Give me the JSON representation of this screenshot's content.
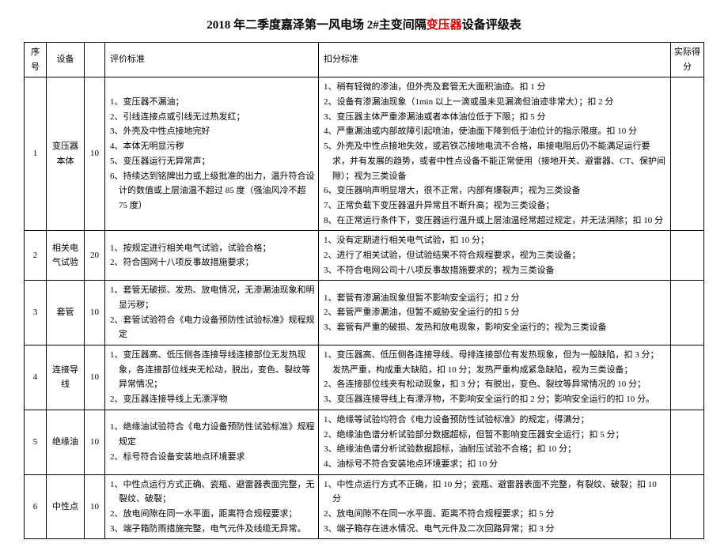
{
  "title_prefix": "2018 年二季度嘉泽第一风电场 2#主变间隔",
  "title_red": "变压器",
  "title_suffix": "设备评级表",
  "headers": {
    "seq": "序号",
    "dev": "设备",
    "score": "",
    "eval": "评价标准",
    "deduct": "扣分标准",
    "actual": "实际得分"
  },
  "rows": [
    {
      "seq": "1",
      "dev": "变压器本体",
      "score": "10",
      "eval": [
        "1、变压器不漏油；",
        "2、引线连接点或引线无过热发红；",
        "3、外壳及中性点接地完好",
        "4、本体无明显污秽",
        "5、变压器运行无异常声；",
        "6、持续达到铭牌出力或上级批准的出力，温升符合设计的数值或上层油温不超过 85 度（强油风冷不超 75 度）"
      ],
      "deduct": [
        "1、稍有轻微的渗油，但外壳及套管无大面积油迹。扣 1 分",
        "2、设备有渗漏油现象（1min 以上一滴或虽未见漏滴但油迹非常大）；扣 2 分",
        "3、变压器主体严重渗漏油或者本体油位低于下限；扣 5 分",
        "4、严重漏油或内部故障引起喷油，使油面下降到低于油位计的指示限度。扣 10 分",
        "5、外壳及中性点接地失效，或若铁芯接地电流不合格，串接电阻后仍不能满足运行要求，并有发展的趋势，或者中性点设备不能正常使用（接地开关、避雷器、CT、保护间隙）；视为三类设备",
        "6、变压器响声明显增大，很不正常，内部有爆裂声；视为三类设备",
        "7、正常负载下变压器温升异常且不断升高；视为三类设备；",
        "8、在正常运行条件下，变压器运行温升或上层油温经常超过规定，并无法消除；扣 10 分"
      ]
    },
    {
      "seq": "2",
      "dev": "相关电气试验",
      "score": "20",
      "eval": [
        "1、按规定进行相关电气试验，试验合格；",
        "2、符合国网十八项反事故措施要求；"
      ],
      "deduct": [
        "1、没有定期进行相关电气试验，扣 10 分；",
        "2、进行了相关试验，但试验结果不符合规程要求，视为三类设备；",
        "3、不符合电网公司十八项反事故措施要求的；视为三类设备"
      ]
    },
    {
      "seq": "3",
      "dev": "套管",
      "score": "10",
      "eval": [
        "1、套管无破损、发热、放电情况，无渗漏油现象和明显污秽；",
        "2、套管试验符合《电力设备预防性试验标准》规程规定"
      ],
      "deduct": [
        "1、套管有渗漏油现象但暂不影响安全运行；扣 2 分",
        "2、套管严重渗漏油，但暂不威胁安全运行的扣 5 分",
        "3、套管有严重的破损、发热和放电现象，影响安全运行的；视为三类设备"
      ]
    },
    {
      "seq": "4",
      "dev": "连接导线",
      "score": "10",
      "eval": [
        "1、变压器高、低压侧各连接导线连接部位无发热现象，各连接部位线夹无松动，脱出，变色、裂纹等异常情况；",
        "2、变压器连接导线上无漂浮物"
      ],
      "deduct": [
        "1、变压器高、低压侧各连接导线、母排连接部位有发热现象，但为一般缺陷，扣 3 分；发热严重，构成重大缺陷，扣 10 分；发热严重构成紧急缺陷，视为三类设备；",
        "2、各连接部位线夹有松动现象，扣 3 分；有脱出，变色、裂纹等异常情况的 10 分；",
        "3、变压器连接导线上有漂浮物，不影响安全运行的扣 2 分；影响安全运行的扣 10 分。"
      ]
    },
    {
      "seq": "5",
      "dev": "绝缘油",
      "score": "10",
      "eval": [
        "1、绝缘油试验符合《电力设备预防性试验标准》规程规定",
        "2、标号符合设备安装地点环境要求"
      ],
      "deduct": [
        "1、绝缘等试验均符合《电力设备预防性试验标准》的规定，得满分；",
        "2、绝缘油色谱分析试验部分数据超标，但暂不影响变压器安全运行；扣 5 分；",
        "3、绝缘油色谱分析试验数据超标，油耐压试验不合格；扣 10 分；",
        "4、油标号不符合安装地点环境要求；扣 10 分"
      ]
    },
    {
      "seq": "6",
      "dev": "中性点",
      "score": "10",
      "eval": [
        "1、中性点运行方式正确、瓷瓶、避雷器表面完整，无裂纹、破裂；",
        "2、放电间隙在同一水平面，距离符合规程要求；",
        "3、端子箱防雨措施完整，电气元件及线缆无异常。"
      ],
      "deduct": [
        "1、中性点运行方式不正确，扣 10 分；瓷瓶、避雷器表面不完整，有裂纹、破裂；扣 10 分",
        "2、放电间隙不在同一水平面、距离不符合规程要求；扣 5 分",
        "3、端子箱存在进水情况、电气元件及二次回路异常；扣 3 分"
      ]
    }
  ]
}
